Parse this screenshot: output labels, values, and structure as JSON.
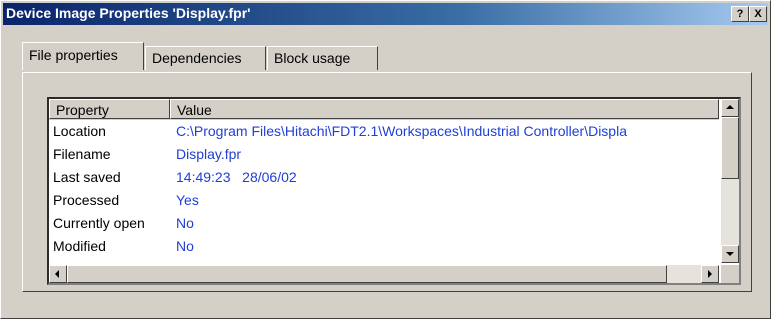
{
  "window": {
    "title": "Device Image Properties 'Display.fpr'",
    "help_label": "?",
    "close_label": "X"
  },
  "tabs": [
    {
      "label": "File properties",
      "active": true
    },
    {
      "label": "Dependencies",
      "active": false
    },
    {
      "label": "Block usage",
      "active": false
    }
  ],
  "list": {
    "columns": [
      "Property",
      "Value"
    ],
    "rows": [
      {
        "property": "Location",
        "value": "C:\\Program Files\\Hitachi\\FDT2.1\\Workspaces\\Industrial Controller\\Displa"
      },
      {
        "property": "Filename",
        "value": "Display.fpr"
      },
      {
        "property": "Last saved",
        "value": "14:49:23   28/06/02"
      },
      {
        "property": "Processed",
        "value": "Yes"
      },
      {
        "property": "Currently open",
        "value": "No"
      },
      {
        "property": "Modified",
        "value": "No"
      }
    ]
  },
  "colors": {
    "titlebar_start": "#0a246a",
    "value_text": "#1f3fd6",
    "face": "#d4d0c8"
  }
}
